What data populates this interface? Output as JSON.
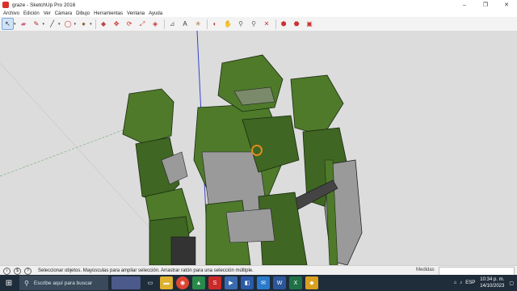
{
  "window": {
    "title": "graze - SketchUp Pro 2016"
  },
  "menu": [
    "Archivo",
    "Edición",
    "Ver",
    "Cámara",
    "Dibujo",
    "Herramientas",
    "Ventana",
    "Ayuda"
  ],
  "toolbar_icons": [
    "select-icon",
    "eraser-icon",
    "pencil-icon",
    "line-icon",
    "circle-icon",
    "paint-icon",
    "push-pull-icon",
    "move-icon",
    "rotate-icon",
    "scale-icon",
    "offset-icon",
    "tape-icon",
    "text-icon",
    "axes-icon",
    "orbit-icon",
    "pan-icon",
    "zoom-icon",
    "zoom-window-icon",
    "zoom-extents-icon",
    "warehouse-icon",
    "extension-icon",
    "layout-icon"
  ],
  "status": {
    "message": "Seleccionar objetos. Mayúsculas para ampliar selección. Arrastrar ratón para una selección múltiple.",
    "measures_label": "Medidas"
  },
  "taskbar": {
    "search_placeholder": "Escribe aquí para buscar",
    "language": "ESP",
    "time": "10:34 p. m.",
    "date": "14/10/2023"
  },
  "colors": {
    "model_green": "#4e7a2a",
    "model_dark_green": "#36591c",
    "model_gray": "#9a9a9a",
    "viewport_bg": "#dcdcdc"
  }
}
